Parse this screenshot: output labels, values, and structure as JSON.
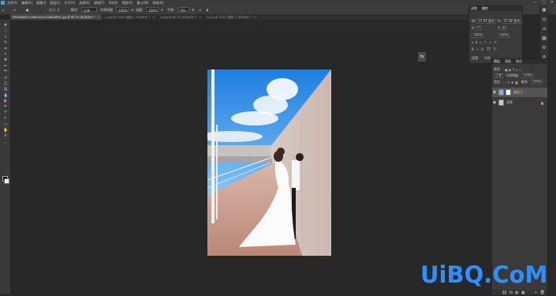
{
  "menu": {
    "app_logo_label": "Ps",
    "items": [
      "文件(F)",
      "编辑(E)",
      "图像(I)",
      "图层(L)",
      "文字(Y)",
      "选择(S)",
      "滤镜(T)",
      "3D(D)",
      "视图(V)",
      "窗口(W)",
      "帮助(H)"
    ],
    "window_controls": [
      "—",
      "□",
      "✕"
    ]
  },
  "options_bar": {
    "brush_size": "大小: 2",
    "mode_label": "模式:",
    "mode_value": "正常",
    "opacity_label": "不透明度:",
    "opacity_value": "100%",
    "flow_label": "流量:",
    "flow_value": "100%",
    "smoothing_label": "平滑:",
    "smoothing_value": "0%"
  },
  "tabs": [
    {
      "label": "9fb5848d37c1f84c0e2ef7ad6c0f691.jpg @ 66.7% (RGB/8#) *",
      "active": true
    },
    {
      "label": "1.png @ 100% (图层 1, RGB/8#) *",
      "active": false
    },
    {
      "label": "2.png @ 66.7% (RGB/8#) *",
      "active": false
    },
    {
      "label": "3.png @ 100% (图层 1, RGB/8#) *",
      "active": false
    }
  ],
  "tools": [
    "move",
    "marquee",
    "lasso",
    "quick-select",
    "crop",
    "eyedropper",
    "healing",
    "brush",
    "clone",
    "history-brush",
    "eraser",
    "gradient",
    "blur",
    "dodge",
    "pen",
    "type",
    "path-select",
    "shape",
    "hand",
    "zoom",
    "more"
  ],
  "tool_glyphs": [
    "✥",
    "⬚",
    "ↄ",
    "✎",
    "⌗",
    "✑",
    "✚",
    "✏",
    "⎃",
    "↺",
    "◫",
    "▤",
    "💧",
    "◐",
    "✒",
    "T",
    "↖",
    "▭",
    "✋",
    "⚲",
    "…"
  ],
  "properties_panel": {
    "header_tabs": [
      "调整",
      "属性"
    ],
    "fields": [
      {
        "label": "W:",
        "value": "23.99 厘米"
      },
      {
        "label": "H:",
        "value": "35.98 厘米"
      },
      {
        "label": "X:",
        "value": "0"
      },
      {
        "label": "Y:",
        "value": "0"
      },
      {
        "label": "",
        "value": "100%"
      },
      {
        "label": "",
        "value": "100%"
      }
    ],
    "bottom_labels": [
      "段落",
      "字符"
    ]
  },
  "float_icon": "⇆",
  "right_strip_icons": [
    "▣",
    "◎",
    "≡",
    "▦",
    "⚙",
    "A",
    "¶",
    "⬡"
  ],
  "layers_panel": {
    "tabs": [
      "图层",
      "通道",
      "路径"
    ],
    "kind_label": "类型",
    "blend_mode": "正常",
    "opacity_label": "不透明度:",
    "opacity_value": "100%",
    "lock_label": "锁定:",
    "fill_label": "填充:",
    "fill_value": "100%",
    "layers": [
      {
        "name": "图层 1",
        "selected": true
      },
      {
        "name": "背景",
        "selected": false
      }
    ],
    "bottom_icons": [
      "⛓",
      "fx",
      "◐",
      "▣",
      "🗀",
      "＋",
      "🗑"
    ]
  },
  "watermark": "UiBQ.CoM",
  "colors": {
    "accent": "#31a8ff",
    "watermark": "#2f8fff",
    "app_bg": "#282828",
    "panel_bg": "#3a3a3a"
  }
}
